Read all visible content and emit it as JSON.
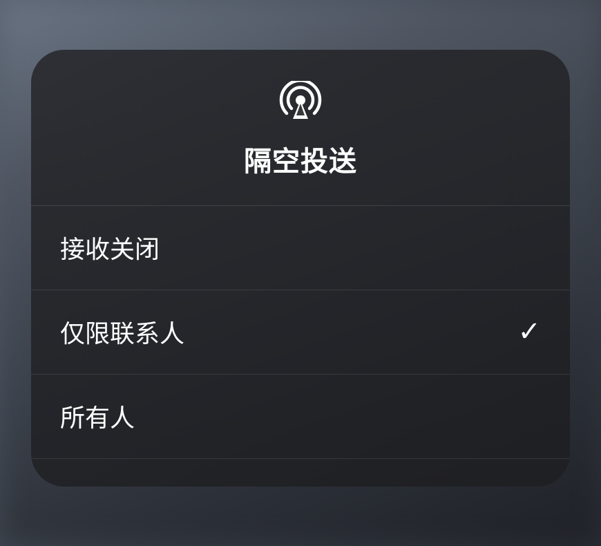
{
  "panel": {
    "title": "隔空投送",
    "icon": "airdrop-icon",
    "options": [
      {
        "label": "接收关闭",
        "selected": false
      },
      {
        "label": "仅限联系人",
        "selected": true
      },
      {
        "label": "所有人",
        "selected": false
      }
    ]
  }
}
